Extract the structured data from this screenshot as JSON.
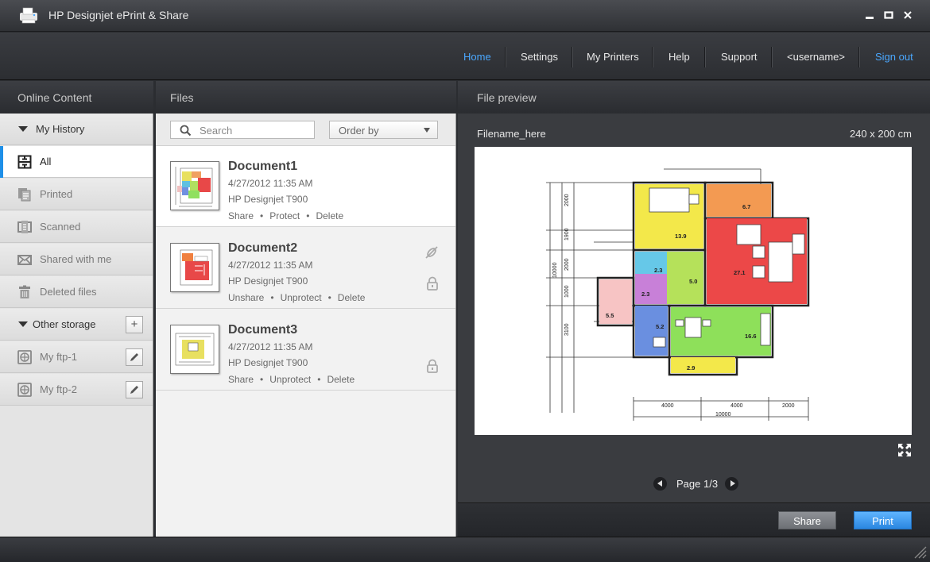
{
  "window": {
    "title": "HP Designjet ePrint & Share",
    "minimize_label": "▬",
    "maximize_label": "■",
    "close_label": "✕"
  },
  "nav": {
    "items": [
      {
        "label": "Home",
        "active": true
      },
      {
        "label": "Settings"
      },
      {
        "label": "My Printers"
      },
      {
        "label": "Help"
      },
      {
        "label": "Support"
      },
      {
        "label": "<username>"
      },
      {
        "label": "Sign out"
      }
    ]
  },
  "columns": {
    "online_content": "Online Content",
    "files": "Files",
    "preview": "File preview"
  },
  "sidebar": {
    "my_history": "My History",
    "history_items": [
      {
        "label": "All",
        "icon": "all-grid-icon",
        "selected": true
      },
      {
        "label": "Printed",
        "icon": "printed-icon"
      },
      {
        "label": "Scanned",
        "icon": "scanned-icon"
      },
      {
        "label": "Shared with me",
        "icon": "envelope-icon"
      },
      {
        "label": "Deleted files",
        "icon": "trash-icon"
      }
    ],
    "other_storage": "Other storage",
    "add_label": "+",
    "storage_items": [
      {
        "label": "My ftp-1",
        "icon": "ftp-icon"
      },
      {
        "label": "My ftp-2",
        "icon": "ftp-icon"
      }
    ]
  },
  "files": {
    "search_placeholder": "Search",
    "order_by": "Order by",
    "documents": [
      {
        "title": "Document1",
        "date": "4/27/2012 11:35 AM",
        "printer": "HP Designjet T900",
        "actions": [
          "Share",
          "Protect",
          "Delete"
        ],
        "selected": true,
        "status_icons": []
      },
      {
        "title": "Document2",
        "date": "4/27/2012 11:35 AM",
        "printer": "HP Designjet T900",
        "actions": [
          "Unshare",
          "Unprotect",
          "Delete"
        ],
        "status_icons": [
          "shared-link-icon",
          "lock-icon"
        ]
      },
      {
        "title": "Document3",
        "date": "4/27/2012 11:35 AM",
        "printer": "HP Designjet T900",
        "actions": [
          "Share",
          "Unprotect",
          "Delete"
        ],
        "status_icons": [
          "lock-icon"
        ]
      }
    ]
  },
  "preview": {
    "filename": "Filename_here",
    "dimensions": "240 x 200 cm",
    "page_label": "Page 1/3",
    "plan_labels": {
      "rooms": [
        "6.7",
        "13.9",
        "27.1",
        "2.3",
        "5.0",
        "2.3",
        "5.5",
        "5.2",
        "16.6",
        "2.9"
      ],
      "dims_left": [
        "2000",
        "1900",
        "2000",
        "1000",
        "3100",
        "10000"
      ],
      "dims_bottom": [
        "4000",
        "4000",
        "2000",
        "10000"
      ]
    }
  },
  "actions": {
    "share": "Share",
    "print": "Print"
  },
  "colors": {
    "accent_blue": "#4aa8ff",
    "selection_bar": "#1e8fe8"
  }
}
